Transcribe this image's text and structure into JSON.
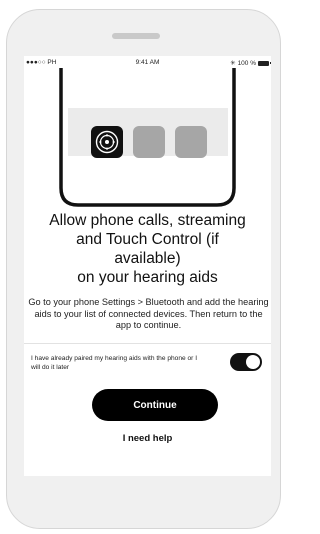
{
  "status_bar": {
    "carrier": "●●●○○ PH",
    "time": "9:41 AM",
    "bluetooth_glyph": "✳",
    "battery": "100 %"
  },
  "illustration": {
    "app_icons": [
      "gear-icon",
      "blank-app-icon",
      "blank-app-icon"
    ]
  },
  "heading": {
    "line1": "Allow phone calls, streaming",
    "line2": "and Touch Control (if",
    "line3": "available)",
    "line4": "on your hearing aids"
  },
  "instructions": "Go to your phone Settings > Bluetooth and add the hearing aids to your list of connected devices. Then return to the app to continue.",
  "toggle": {
    "label": "I have already paired my hearing aids with the phone or I will do it later",
    "state": "on"
  },
  "buttons": {
    "continue": "Continue",
    "help": "I need help"
  }
}
